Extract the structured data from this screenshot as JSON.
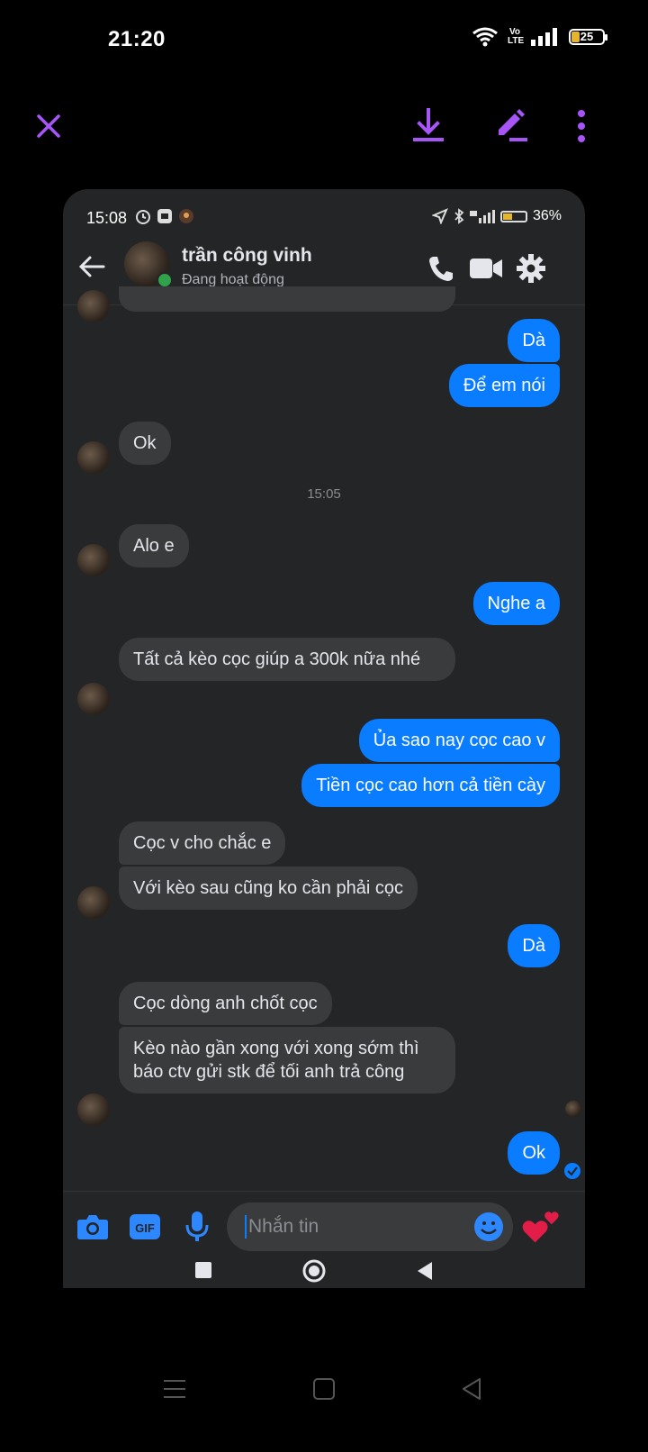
{
  "os_status": {
    "time": "21:20",
    "volte": "Vo LTE",
    "battery": "25"
  },
  "viewer": {
    "icons": [
      "close-icon",
      "download-icon",
      "edit-icon",
      "more-icon"
    ]
  },
  "inner_status": {
    "time": "15:08",
    "battery": "36%"
  },
  "chat": {
    "name": "trần công vinh",
    "status": "Đang hoạt động",
    "timestamp": "15:05",
    "composer_placeholder": "Nhắn tin"
  },
  "messages": [
    {
      "from": "me",
      "text": "Dà"
    },
    {
      "from": "me",
      "text": "Để em nói"
    },
    {
      "from": "them",
      "text": "Ok"
    },
    {
      "from": "them",
      "text": "Alo e"
    },
    {
      "from": "me",
      "text": "Nghe a"
    },
    {
      "from": "them",
      "text": "Tất cả kèo cọc giúp a 300k nữa nhé"
    },
    {
      "from": "me",
      "text": "Ủa sao nay cọc cao v"
    },
    {
      "from": "me",
      "text": "Tiền cọc cao hơn cả tiền cày"
    },
    {
      "from": "them",
      "text": "Cọc v cho chắc e"
    },
    {
      "from": "them",
      "text": "Với kèo sau cũng ko cần phải cọc"
    },
    {
      "from": "me",
      "text": "Dà"
    },
    {
      "from": "them",
      "text": "Cọc dòng anh chốt cọc"
    },
    {
      "from": "them",
      "text": "Kèo nào gần xong với xong sớm thì báo ctv gửi stk để tối anh trả công"
    },
    {
      "from": "me",
      "text": "Ok"
    }
  ],
  "colors": {
    "accent_viewer": "#a855f7",
    "messenger_blue": "#0a7cff",
    "bubble_in": "#3a3b3c"
  }
}
